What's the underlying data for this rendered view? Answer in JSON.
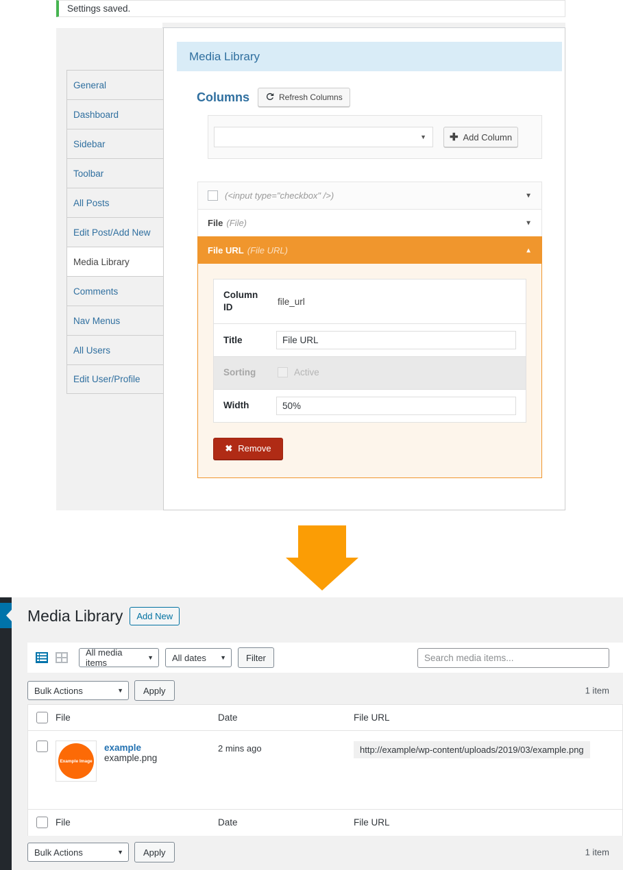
{
  "settings": {
    "notice": "Settings saved.",
    "nav": [
      {
        "label": "General",
        "active": false
      },
      {
        "label": "Dashboard",
        "active": false
      },
      {
        "label": "Sidebar",
        "active": false
      },
      {
        "label": "Toolbar",
        "active": false
      },
      {
        "label": "All Posts",
        "active": false
      },
      {
        "label": "Edit Post/Add New",
        "active": false
      },
      {
        "label": "Media Library",
        "active": true
      },
      {
        "label": "Comments",
        "active": false
      },
      {
        "label": "Nav Menus",
        "active": false
      },
      {
        "label": "All Users",
        "active": false
      },
      {
        "label": "Edit User/Profile",
        "active": false
      }
    ],
    "banner_title": "Media Library",
    "columns_title": "Columns",
    "refresh_label": "Refresh Columns",
    "add_column_label": "Add Column",
    "add_select_value": "",
    "rows": [
      {
        "label": "",
        "sub": "(<input type=\"checkbox\" />)",
        "has_checkbox": true,
        "open": false
      },
      {
        "label": "File",
        "sub": "(File)",
        "has_checkbox": false,
        "open": false
      },
      {
        "label": "File URL",
        "sub": "(File URL)",
        "has_checkbox": false,
        "open": true
      }
    ],
    "detail": {
      "column_id_label": "Column ID",
      "column_id_value": "file_url",
      "title_label": "Title",
      "title_value": "File URL",
      "sorting_label": "Sorting",
      "sorting_checkbox_label": "Active",
      "width_label": "Width",
      "width_value": "50%",
      "remove_label": "Remove"
    }
  },
  "media": {
    "title": "Media Library",
    "add_new_label": "Add New",
    "filter_media": "All media items",
    "filter_dates": "All dates",
    "filter_button": "Filter",
    "search_placeholder": "Search media items...",
    "bulk_actions_label": "Bulk Actions",
    "apply_label": "Apply",
    "item_count": "1 item",
    "columns": [
      "File",
      "Date",
      "File URL"
    ],
    "row": {
      "thumb_text": "Example Image",
      "title": "example",
      "filename": "example.png",
      "date": "2 mins ago",
      "file_url": "http://example/wp-content/uploads/2019/03/example.png"
    }
  },
  "colors": {
    "accent_orange": "#f0962d",
    "wp_blue": "#0073aa",
    "notice_green": "#46b450",
    "danger_red": "#b02b15",
    "thumb_orange": "#fc6a06"
  }
}
